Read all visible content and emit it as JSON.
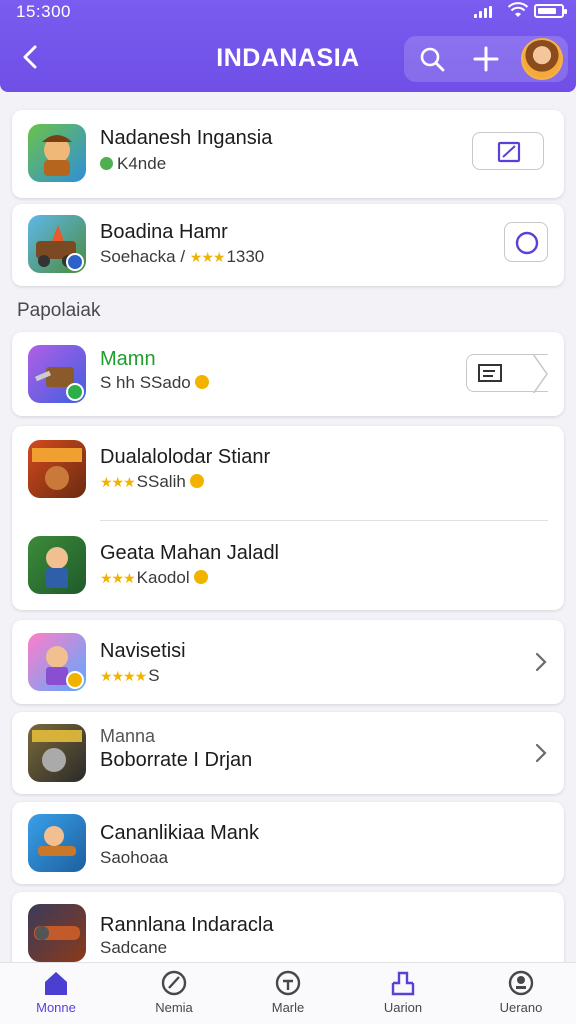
{
  "status_bar": {
    "time": "15:300"
  },
  "header": {
    "title": "INDANASIA",
    "icons": [
      "back-chevron-icon",
      "search-icon",
      "plus-icon",
      "avatar"
    ]
  },
  "section_label": "Papolaiak",
  "cards": [
    {
      "name": "Nadanesh Ingansia",
      "sub": "K4nde",
      "action": "edit-square-button"
    },
    {
      "name": "Boadina Hamr",
      "sub": "Soehacka / ",
      "stars": "★★★",
      "sub_tail": "1330",
      "action": "circle-button"
    },
    {
      "name": "Mamn",
      "sub": "S hh SSado",
      "action": "tag-button"
    },
    {
      "name": "Dualalolodar Stianr",
      "stars": "★★★",
      "sub": "SSalih"
    },
    {
      "name": "Geata Mahan Jaladl",
      "stars": "★★★",
      "sub": "Kaodol"
    },
    {
      "name": "Navisetisi",
      "stars": "★★★★",
      "sub": "S"
    },
    {
      "name": "Boborrate I Drjan",
      "tag": "Manna"
    },
    {
      "name": "Cananlikiaa Mank",
      "sub": "Saohoaa"
    },
    {
      "name": "Rannlana Indaracla",
      "sub": "Sadcane"
    }
  ],
  "nav": [
    {
      "label": "Monne",
      "icon": "home-icon",
      "active": true
    },
    {
      "label": "Nemia",
      "icon": "compass-icon",
      "active": false
    },
    {
      "label": "Marle",
      "icon": "target-icon",
      "active": false
    },
    {
      "label": "Uarion",
      "icon": "inbox-icon",
      "active": false
    },
    {
      "label": "Uerano",
      "icon": "profile-icon",
      "active": false
    }
  ],
  "colors": {
    "header": "#6f4fe6",
    "accent": "#5b3fd8",
    "star": "#f2b300",
    "green": "#1e9e2c"
  }
}
